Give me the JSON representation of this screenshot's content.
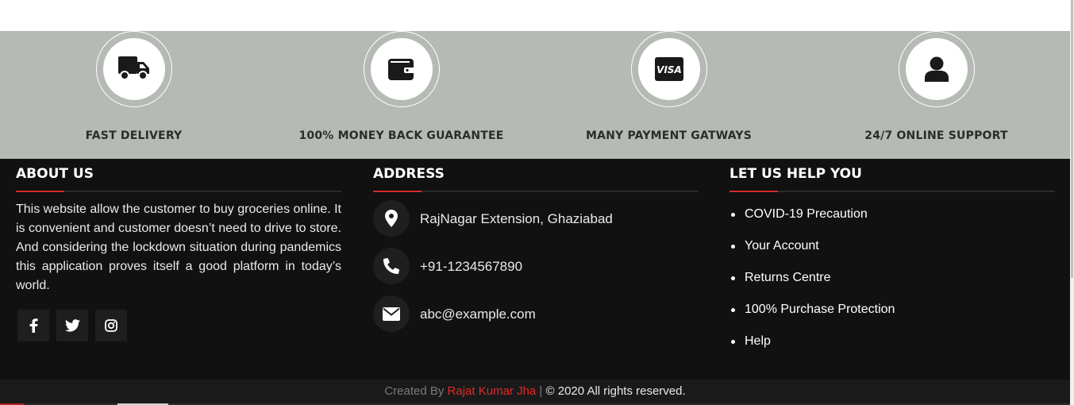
{
  "features": [
    {
      "label": "FAST DELIVERY",
      "icon": "truck-icon"
    },
    {
      "label": "100% MONEY BACK GUARANTEE",
      "icon": "wallet-icon"
    },
    {
      "label": "MANY PAYMENT GATWAYS",
      "icon": "visa-card-icon"
    },
    {
      "label": "24/7 ONLINE SUPPORT",
      "icon": "user-icon"
    }
  ],
  "visa_text": "VISA",
  "about": {
    "title": "ABOUT US",
    "text": "This website allow the customer to buy groceries online. It is convenient and customer doesn’t need to drive to store. And considering the lockdown situation during pandemics this application proves itself a good platform in today’s world.",
    "socials": [
      "facebook-icon",
      "twitter-icon",
      "instagram-icon"
    ]
  },
  "address": {
    "title": "ADDRESS",
    "items": [
      {
        "icon": "map-marker-icon",
        "text": "RajNagar Extension, Ghaziabad"
      },
      {
        "icon": "phone-icon",
        "text": "+91-1234567890"
      },
      {
        "icon": "envelope-icon",
        "text": "abc@example.com"
      }
    ]
  },
  "help": {
    "title": "LET US HELP YOU",
    "links": [
      "COVID-19 Precaution",
      "Your Account",
      "Returns Centre",
      "100% Purchase Protection",
      "Help"
    ]
  },
  "copyright": {
    "prefix": "Created By ",
    "author": "Rajat Kumar Jha",
    "separator": " | ",
    "symbol": "©",
    "rights": " 2020 All rights reserved."
  },
  "colors": {
    "feature_band": "#b6bab5",
    "footer_bg": "#111111",
    "accent_red": "#d42a24"
  }
}
